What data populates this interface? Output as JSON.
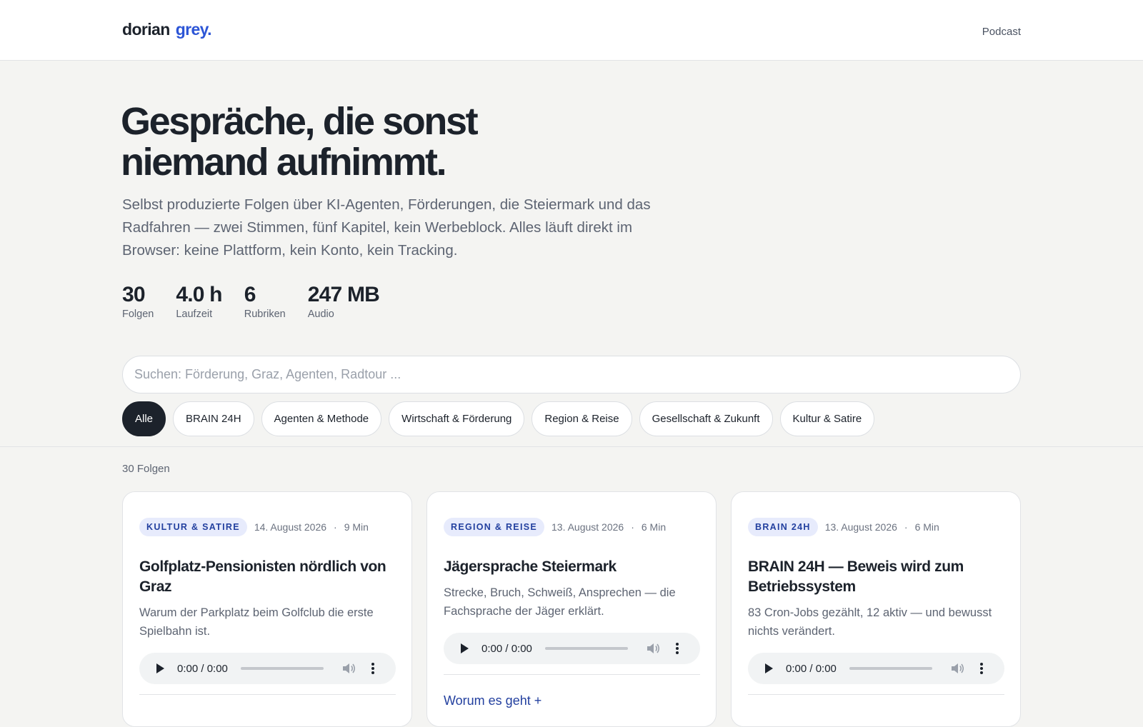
{
  "header": {
    "logo_part1": "dorian",
    "logo_part2": "grey.",
    "nav_podcast": "Podcast"
  },
  "hero": {
    "title": "Gespräche, die sonst niemand aufnimmt.",
    "description": "Selbst produzierte Folgen über KI-Agenten, Förderungen, die Steiermark und das Radfahren — zwei Stimmen, fünf Kapitel, kein Werbeblock. Alles läuft direkt im Browser: keine Plattform, kein Konto, kein Tracking."
  },
  "stats": [
    {
      "value": "30",
      "label": "Folgen"
    },
    {
      "value": "4.0 h",
      "label": "Laufzeit"
    },
    {
      "value": "6",
      "label": "Rubriken"
    },
    {
      "value": "247 MB",
      "label": "Audio"
    }
  ],
  "search": {
    "placeholder": "Suchen: Förderung, Graz, Agenten, Radtour ..."
  },
  "filters": [
    {
      "label": "Alle",
      "active": true
    },
    {
      "label": "BRAIN 24H",
      "active": false
    },
    {
      "label": "Agenten & Methode",
      "active": false
    },
    {
      "label": "Wirtschaft & Förderung",
      "active": false
    },
    {
      "label": "Region & Reise",
      "active": false
    },
    {
      "label": "Gesellschaft & Zukunft",
      "active": false
    },
    {
      "label": "Kultur & Satire",
      "active": false
    }
  ],
  "episode_count": "30 Folgen",
  "episodes": [
    {
      "category": "KULTUR & SATIRE",
      "date": "14. August 2026",
      "separator": "·",
      "duration": "9 Min",
      "title": "Golfplatz-Pensionisten nördlich von Graz",
      "description": "Warum der Parkplatz beim Golfclub die erste Spielbahn ist.",
      "player_time": "0:00 / 0:00"
    },
    {
      "category": "REGION & REISE",
      "date": "13. August 2026",
      "separator": "·",
      "duration": "6 Min",
      "title": "Jägersprache Steiermark",
      "description": "Strecke, Bruch, Schweiß, Ansprechen — die Fachsprache der Jäger erklärt.",
      "player_time": "0:00 / 0:00",
      "more_link": "Worum es geht +"
    },
    {
      "category": "BRAIN 24H",
      "date": "13. August 2026",
      "separator": "·",
      "duration": "6 Min",
      "title": "BRAIN 24H — Beweis wird zum Betriebssystem",
      "description": "83 Cron-Jobs gezählt, 12 aktiv — und bewusst nichts verändert.",
      "player_time": "0:00 / 0:00"
    }
  ],
  "colors": {
    "accent": "#2c55d6",
    "badge_bg": "#e7ebfc",
    "badge_text": "#23409f",
    "dark": "#1c222b",
    "page_bg": "#f4f4f2"
  }
}
